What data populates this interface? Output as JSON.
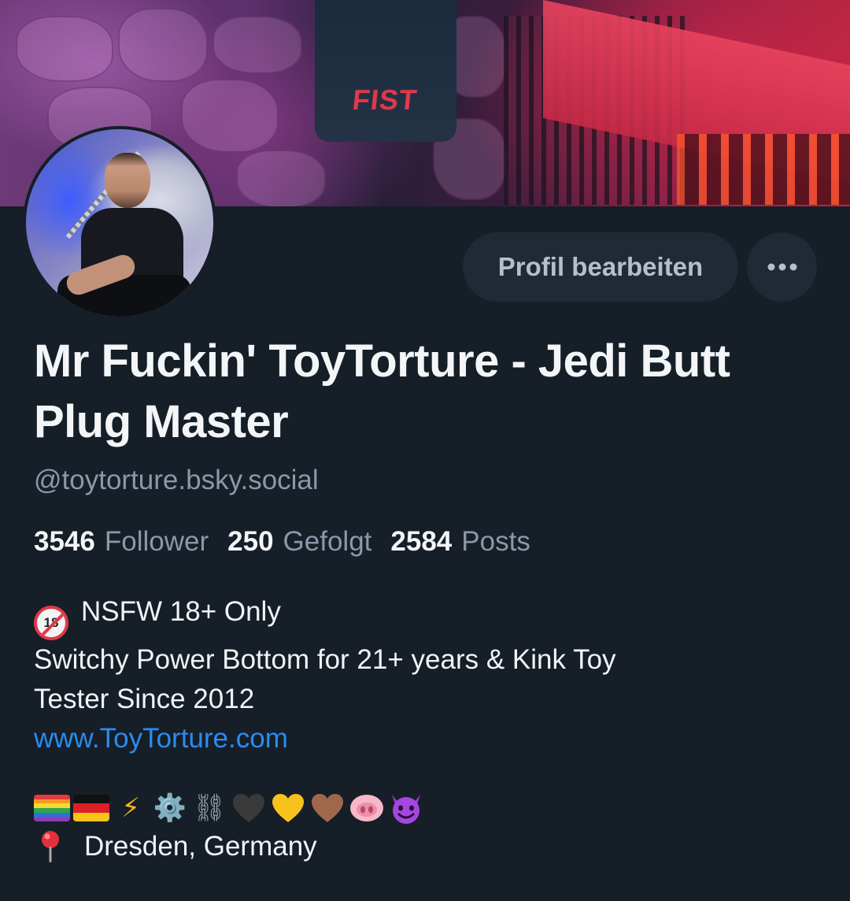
{
  "banner": {
    "label": "FIST"
  },
  "actions": {
    "edit_profile_label": "Profil bearbeiten",
    "more_icon": "more-horizontal-icon"
  },
  "profile": {
    "display_name": "Mr Fuckin' ToyTorture - Jedi Butt Plug Master",
    "handle": "@toytorture.bsky.social",
    "stats": [
      {
        "count": "3546",
        "label": "Follower"
      },
      {
        "count": "250",
        "label": "Gefolgt"
      },
      {
        "count": "2584",
        "label": "Posts"
      }
    ],
    "bio": {
      "line1": "NSFW 18+ Only",
      "line2": "Switchy Power Bottom for 21+ years & Kink Toy",
      "line3": "Tester Since 2012",
      "link": "www.ToyTorture.com"
    },
    "badge_18_text": "18",
    "emojis": [
      "rainbow-flag",
      "germany-flag",
      "⚡",
      "⚙️",
      "⛓",
      "black-heart",
      "yellow-heart",
      "brown-heart",
      "pig-nose",
      "smiling-imp"
    ],
    "location": "Dresden, Germany"
  },
  "colors": {
    "background": "#161e27",
    "button_bg": "#1f2a35",
    "link": "#2a8cf0",
    "muted_text": "#8a99a8"
  }
}
